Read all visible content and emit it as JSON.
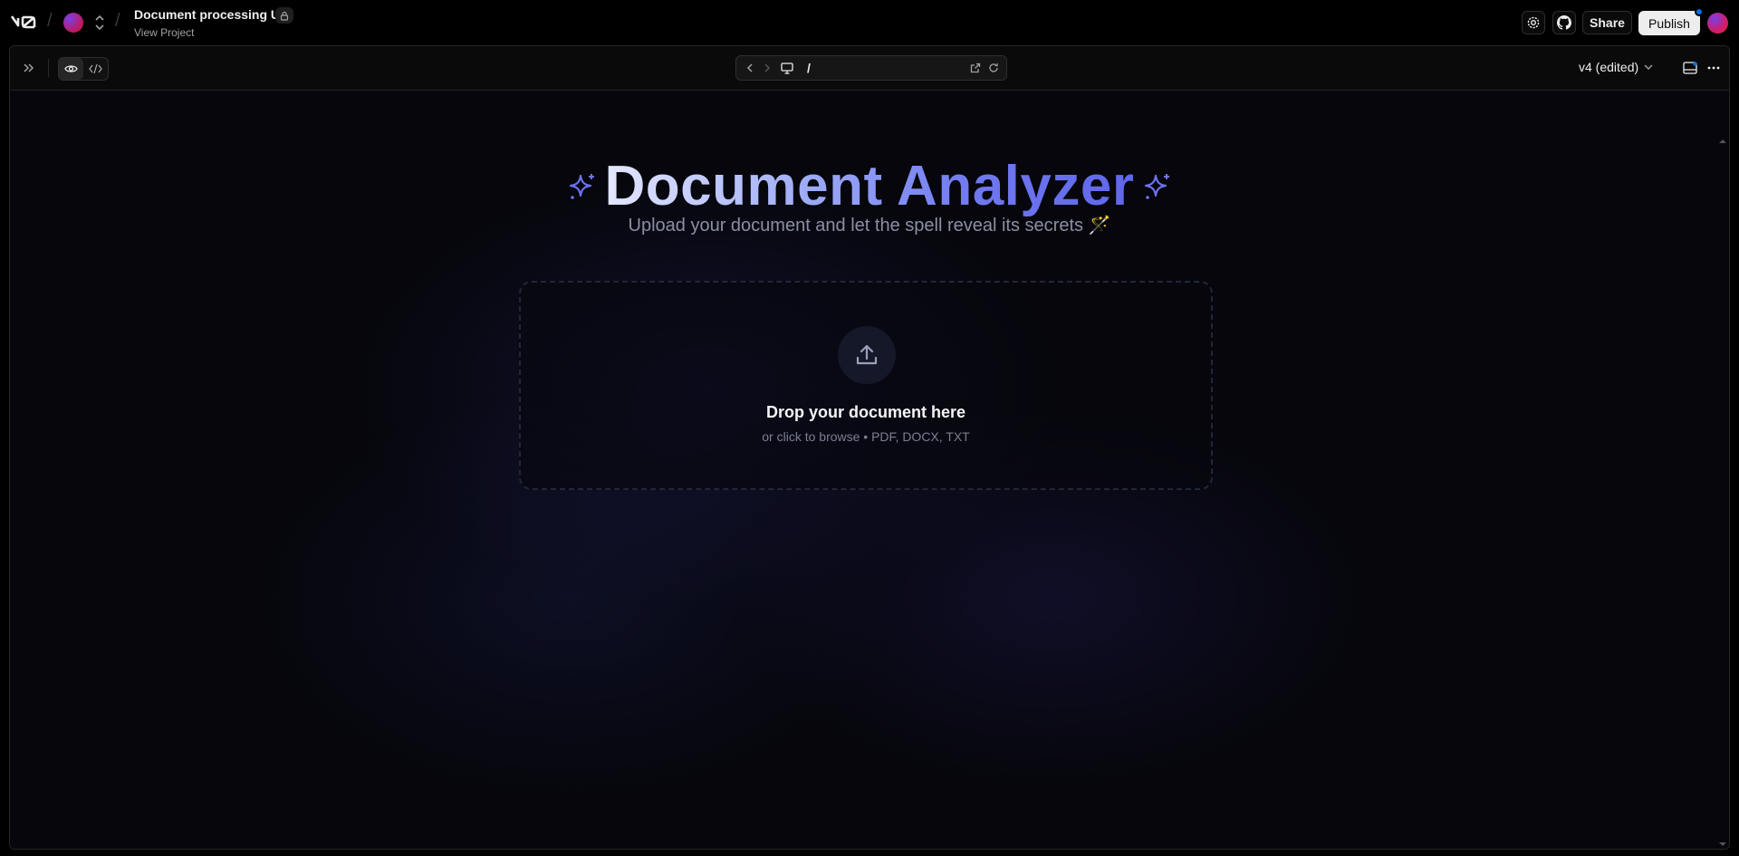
{
  "header": {
    "project_title": "Document processing UI",
    "project_link": "View Project",
    "share_label": "Share",
    "publish_label": "Publish"
  },
  "preview": {
    "url_path": "/",
    "version_label": "v4 (edited)"
  },
  "app": {
    "title": "Document Analyzer",
    "subtitle": "Upload your document and let the spell reveal its secrets 🪄",
    "drop_title": "Drop your document here",
    "drop_subtitle": "or click to browse • PDF, DOCX, TXT"
  },
  "icons": {
    "logo": "v0-logo-icon",
    "sparkle": "sparkle-icon",
    "upload": "upload-icon",
    "settings": "gear-icon",
    "github": "github-icon",
    "lock": "lock-icon"
  },
  "colors": {
    "accent": "#6366f1",
    "title_gradient_start": "#e4e8ff",
    "title_gradient_end": "#6066ea",
    "publish_dot": "#0070f3"
  }
}
